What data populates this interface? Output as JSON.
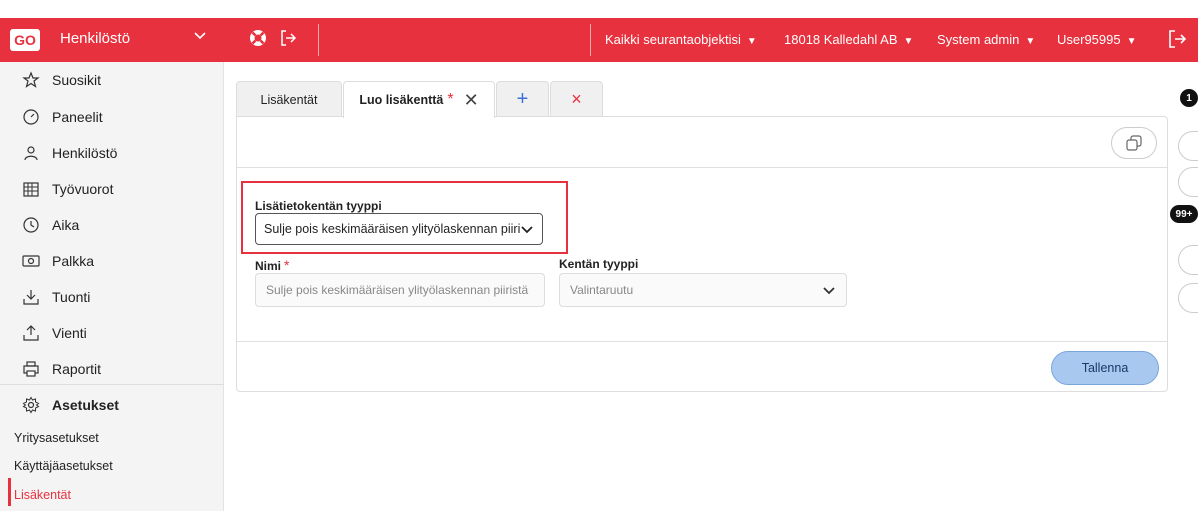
{
  "header": {
    "logo_text": "GO",
    "app_name": "Henkilöstö",
    "nav": [
      {
        "label": "Kaikki seurantaobjektisi"
      },
      {
        "label": "18018 Kalledahl AB"
      },
      {
        "label": "System admin"
      },
      {
        "label": "User95995"
      }
    ],
    "accent_color": "#e8313e"
  },
  "sidebar": {
    "items": [
      {
        "label": "Suosikit",
        "icon": "star-icon"
      },
      {
        "label": "Paneelit",
        "icon": "gauge-icon"
      },
      {
        "label": "Henkilöstö",
        "icon": "people-icon"
      },
      {
        "label": "Työvuorot",
        "icon": "calendar-icon"
      },
      {
        "label": "Aika",
        "icon": "clock-icon"
      },
      {
        "label": "Palkka",
        "icon": "money-icon"
      },
      {
        "label": "Tuonti",
        "icon": "import-icon"
      },
      {
        "label": "Vienti",
        "icon": "export-icon"
      },
      {
        "label": "Raportit",
        "icon": "printer-icon"
      },
      {
        "label": "Asetukset",
        "icon": "gear-icon"
      }
    ],
    "subitems": [
      {
        "label": "Yritysasetukset"
      },
      {
        "label": "Käyttäjäasetukset"
      },
      {
        "label": "Lisäkentät"
      }
    ]
  },
  "tabs": [
    {
      "label": "Lisäkentät"
    },
    {
      "label": "Luo lisäkenttä",
      "star": "*"
    },
    {
      "label": "+"
    },
    {
      "label": "×"
    }
  ],
  "form": {
    "type_label": "Lisätietokentän tyyppi",
    "type_value": "Sulje pois keskimääräisen ylityölaskennan piiristä",
    "name_label": "Nimi",
    "required_mark": "*",
    "name_value": "Sulje pois keskimääräisen ylityölaskennan piiristä",
    "field_type_label": "Kentän tyyppi",
    "field_type_value": "Valintaruutu",
    "save_label": "Tallenna"
  },
  "right_rail": {
    "badge_top": "1",
    "badge_count": "99+"
  }
}
